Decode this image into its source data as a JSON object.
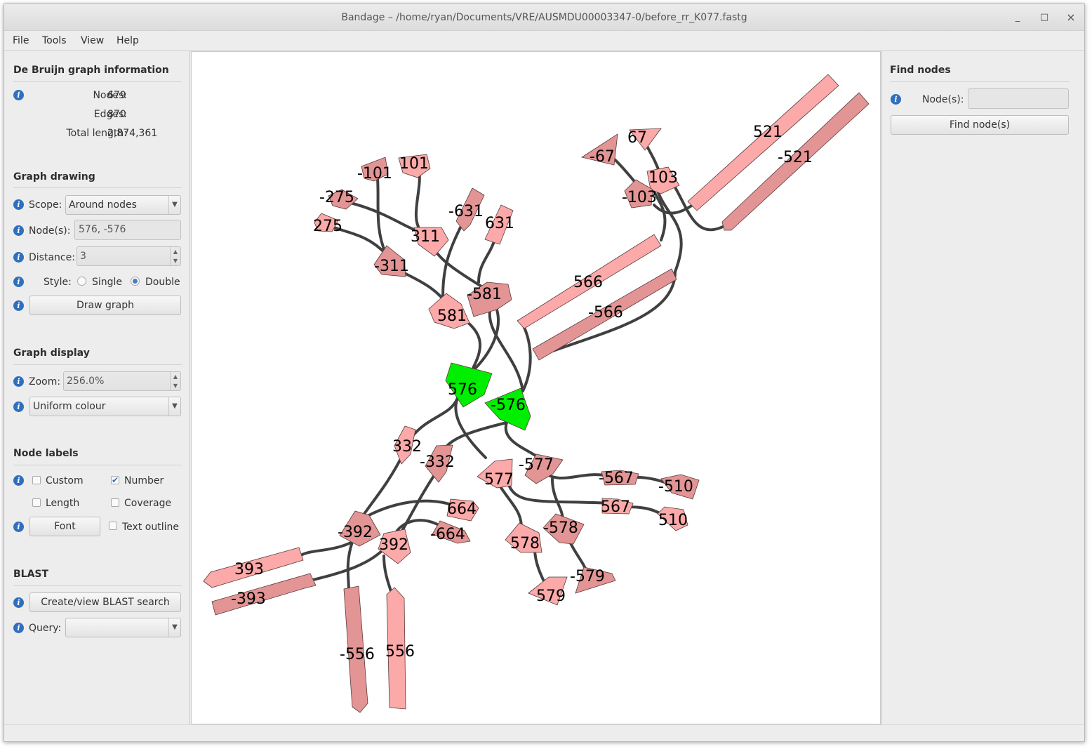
{
  "window": {
    "title": "Bandage – /home/ryan/Documents/VRE/AUSMDU00003347-0/before_rr_K077.fastg",
    "minimize": "_",
    "maximize": "□",
    "close": "×"
  },
  "menu": [
    "File",
    "Tools",
    "View",
    "Help"
  ],
  "graph_info": {
    "title": "De Bruijn graph information",
    "nodes_label": "Nodes:",
    "nodes": "679",
    "edges_label": "Edges:",
    "edges": "870",
    "length_label": "Total length:",
    "length": "2,874,361"
  },
  "graph_drawing": {
    "title": "Graph drawing",
    "scope_label": "Scope:",
    "scope_value": "Around nodes",
    "nodes_label": "Node(s):",
    "nodes_value": "576, -576",
    "distance_label": "Distance:",
    "distance_value": "3",
    "style_label": "Style:",
    "style_single": "Single",
    "style_double": "Double",
    "style_selected": "Double",
    "draw_button": "Draw graph"
  },
  "graph_display": {
    "title": "Graph display",
    "zoom_label": "Zoom:",
    "zoom_value": "256.0%",
    "colour_value": "Uniform colour"
  },
  "node_labels": {
    "title": "Node labels",
    "custom": "Custom",
    "custom_checked": false,
    "number": "Number",
    "number_checked": true,
    "length": "Length",
    "length_checked": false,
    "coverage": "Coverage",
    "coverage_checked": false,
    "font_button": "Font",
    "text_outline": "Text outline",
    "text_outline_checked": false
  },
  "blast": {
    "title": "BLAST",
    "search_button": "Create/view BLAST search",
    "query_label": "Query:",
    "query_value": ""
  },
  "find_nodes": {
    "title": "Find nodes",
    "nodes_label": "Node(s):",
    "nodes_value": "",
    "button": "Find node(s)"
  },
  "colors": {
    "node_pos": "#fba9a9",
    "node_neg": "#e39494",
    "node_selected": "#00ee00",
    "edge": "#404040",
    "info_icon": "#2f6fbd"
  },
  "graph": {
    "node_labels": [
      "521",
      "-521",
      "67",
      "-67",
      "103",
      "-103",
      "101",
      "-101",
      "-275",
      "275",
      "311",
      "-311",
      "-631",
      "631",
      "-581",
      "581",
      "566",
      "-566",
      "576",
      "-576",
      "332",
      "-332",
      "-577",
      "577",
      "-567",
      "-510",
      "567",
      "510",
      "664",
      "-664",
      "-392",
      "392",
      "-578",
      "578",
      "-579",
      "579",
      "393",
      "-393",
      "-556",
      "556"
    ]
  }
}
